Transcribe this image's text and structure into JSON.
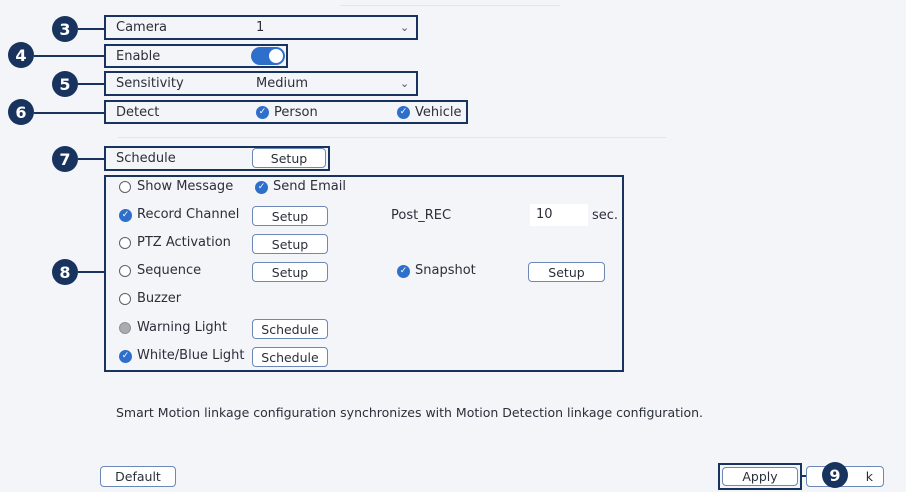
{
  "colors": {
    "accent": "#2f6fcc",
    "annotation": "#17335e",
    "background": "#f4f5f8"
  },
  "settings": {
    "camera": {
      "label": "Camera",
      "value": "1"
    },
    "enable": {
      "label": "Enable",
      "on": true
    },
    "sensitivity": {
      "label": "Sensitivity",
      "value": "Medium"
    },
    "detect": {
      "label": "Detect",
      "options": [
        {
          "label": "Person",
          "checked": true
        },
        {
          "label": "Vehicle",
          "checked": true
        }
      ]
    },
    "schedule": {
      "label": "Schedule",
      "button": "Setup"
    }
  },
  "linkage": {
    "show_message": {
      "label": "Show Message",
      "checked": false
    },
    "send_email": {
      "label": "Send Email",
      "checked": true
    },
    "record_channel": {
      "label": "Record Channel",
      "checked": true,
      "button": "Setup"
    },
    "post_rec": {
      "label": "Post_REC",
      "value": "10",
      "unit": "sec."
    },
    "ptz": {
      "label": "PTZ Activation",
      "checked": false,
      "button": "Setup"
    },
    "sequence": {
      "label": "Sequence",
      "checked": false,
      "button": "Setup"
    },
    "snapshot": {
      "label": "Snapshot",
      "checked": true,
      "button": "Setup"
    },
    "buzzer": {
      "label": "Buzzer",
      "checked": false
    },
    "warning_light": {
      "label": "Warning Light",
      "checked": false,
      "button": "Schedule"
    },
    "white_blue_light": {
      "label": "White/Blue Light",
      "checked": true,
      "button": "Schedule"
    }
  },
  "note": "Smart Motion linkage configuration synchronizes with Motion Detection linkage configuration.",
  "footer": {
    "default": "Default",
    "apply": "Apply",
    "back_partial": "k"
  },
  "callouts": {
    "c3": "3",
    "c4": "4",
    "c5": "5",
    "c6": "6",
    "c7": "7",
    "c8": "8",
    "c9": "9"
  }
}
